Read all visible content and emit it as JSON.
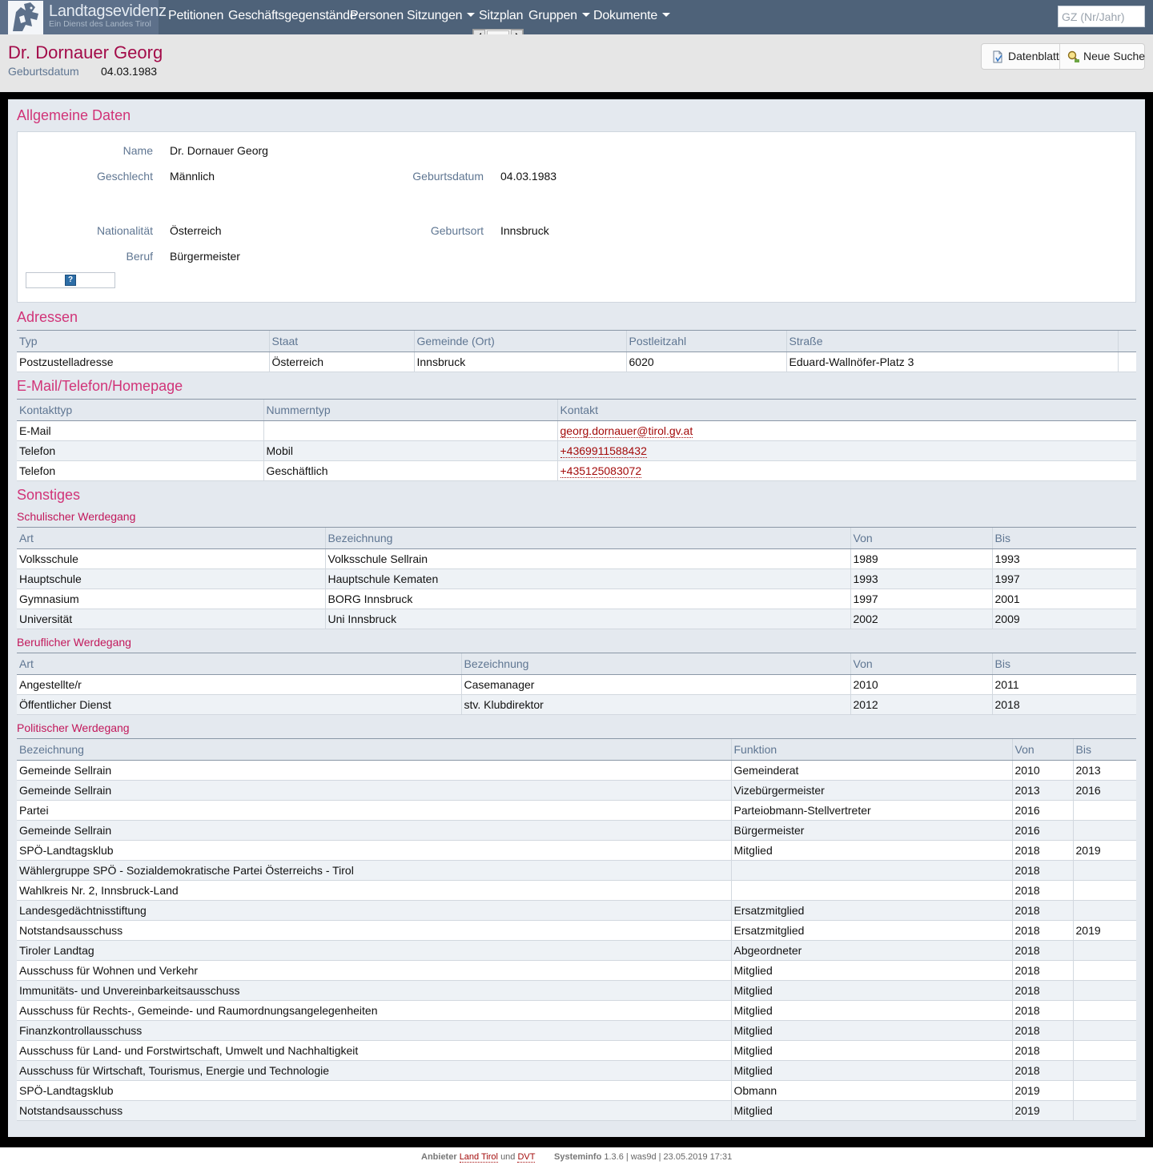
{
  "brand": {
    "title": "Landtagsevidenz",
    "subtitle": "Ein Dienst des Landes Tirol"
  },
  "nav": {
    "items": [
      {
        "label": "Petitionen",
        "dropdown": false
      },
      {
        "label": "Geschäftsgegenstände",
        "dropdown": false
      },
      {
        "label": "Personen",
        "dropdown": false
      },
      {
        "label": "Sitzungen",
        "dropdown": true
      },
      {
        "label": "Sitzplan",
        "dropdown": false
      },
      {
        "label": "Gruppen",
        "dropdown": true
      },
      {
        "label": "Dokumente",
        "dropdown": true
      }
    ],
    "search_placeholder": "GZ (Nr/Jahr)",
    "search_value": ""
  },
  "header": {
    "title": "Dr. Dornauer Georg",
    "dob_label": "Geburtsdatum",
    "dob_value": "04.03.1983",
    "buttons": {
      "datenblatt": "Datenblatt",
      "neue_suche": "Neue Suche"
    }
  },
  "general": {
    "heading": "Allgemeine Daten",
    "name_label": "Name",
    "name": "Dr. Dornauer Georg",
    "gender_label": "Geschlecht",
    "gender": "Männlich",
    "birthdate_label": "Geburtsdatum",
    "birthdate": "04.03.1983",
    "nationality_label": "Nationalität",
    "nationality": "Österreich",
    "birthplace_label": "Geburtsort",
    "birthplace": "Innsbruck",
    "job_label": "Beruf",
    "job": "Bürgermeister",
    "image_placeholder": "?"
  },
  "addresses": {
    "heading": "Adressen",
    "columns": [
      "Typ",
      "Staat",
      "Gemeinde (Ort)",
      "Postleitzahl",
      "Straße"
    ],
    "rows": [
      [
        "Postzustelladresse",
        "Österreich",
        "Innsbruck",
        "6020",
        "Eduard-Wallnöfer-Platz 3"
      ]
    ]
  },
  "contacts": {
    "heading": "E-Mail/Telefon/Homepage",
    "columns": [
      "Kontakttyp",
      "Nummerntyp",
      "Kontakt"
    ],
    "rows": [
      [
        "E-Mail",
        "",
        "georg.dornauer@tirol.gv.at"
      ],
      [
        "Telefon",
        "Mobil",
        "+4369911588432"
      ],
      [
        "Telefon",
        "Geschäftlich",
        "+435125083072"
      ]
    ]
  },
  "misc": {
    "heading": "Sonstiges"
  },
  "school": {
    "heading": "Schulischer Werdegang",
    "columns": [
      "Art",
      "Bezeichnung",
      "Von",
      "Bis"
    ],
    "rows": [
      [
        "Volksschule",
        "Volksschule Sellrain",
        "1989",
        "1993"
      ],
      [
        "Hauptschule",
        "Hauptschule Kematen",
        "1993",
        "1997"
      ],
      [
        "Gymnasium",
        "BORG Innsbruck",
        "1997",
        "2001"
      ],
      [
        "Universität",
        "Uni Innsbruck",
        "2002",
        "2009"
      ]
    ]
  },
  "career": {
    "heading": "Beruflicher Werdegang",
    "columns": [
      "Art",
      "Bezeichnung",
      "Von",
      "Bis"
    ],
    "rows": [
      [
        "Angestellte/r",
        "Casemanager",
        "2010",
        "2011"
      ],
      [
        "Öffentlicher Dienst",
        "stv. Klubdirektor",
        "2012",
        "2018"
      ]
    ]
  },
  "political": {
    "heading": "Politischer Werdegang",
    "columns": [
      "Bezeichnung",
      "Funktion",
      "Von",
      "Bis"
    ],
    "rows": [
      [
        "Gemeinde Sellrain",
        "Gemeinderat",
        "2010",
        "2013"
      ],
      [
        "Gemeinde Sellrain",
        "Vizebürgermeister",
        "2013",
        "2016"
      ],
      [
        "Partei",
        "Parteiobmann-Stellvertreter",
        "2016",
        ""
      ],
      [
        "Gemeinde Sellrain",
        "Bürgermeister",
        "2016",
        ""
      ],
      [
        "SPÖ-Landtagsklub",
        "Mitglied",
        "2018",
        "2019"
      ],
      [
        "Wählergruppe SPÖ - Sozialdemokratische Partei Österreichs - Tirol",
        "",
        "2018",
        ""
      ],
      [
        "Wahlkreis Nr. 2, Innsbruck-Land",
        "",
        "2018",
        ""
      ],
      [
        "Landesgedächtnisstiftung",
        "Ersatzmitglied",
        "2018",
        ""
      ],
      [
        "Notstandsausschuss",
        "Ersatzmitglied",
        "2018",
        "2019"
      ],
      [
        "Tiroler Landtag",
        "Abgeordneter",
        "2018",
        ""
      ],
      [
        "Ausschuss für Wohnen und Verkehr",
        "Mitglied",
        "2018",
        ""
      ],
      [
        "Immunitäts- und Unvereinbarkeitsausschuss",
        "Mitglied",
        "2018",
        ""
      ],
      [
        "Ausschuss für Rechts-, Gemeinde- und Raumordnungsangelegenheiten",
        "Mitglied",
        "2018",
        ""
      ],
      [
        "Finanzkontrollausschuss",
        "Mitglied",
        "2018",
        ""
      ],
      [
        "Ausschuss für Land- und Forstwirtschaft, Umwelt und Nachhaltigkeit",
        "Mitglied",
        "2018",
        ""
      ],
      [
        "Ausschuss für Wirtschaft, Tourismus, Energie und Technologie",
        "Mitglied",
        "2018",
        ""
      ],
      [
        "SPÖ-Landtagsklub",
        "Obmann",
        "2019",
        ""
      ],
      [
        "Notstandsausschuss",
        "Mitglied",
        "2019",
        ""
      ]
    ]
  },
  "footer": {
    "provider_label": "Anbieter",
    "provider_1": "Land Tirol",
    "and": "und",
    "provider_2": "DVT",
    "sysinfo_label": "Systeminfo",
    "sysinfo": "1.3.6 | was9d | 23.05.2019 17:31"
  },
  "colors": {
    "navbar": "#4e6279",
    "heading": "#d13478",
    "title": "#a30b49",
    "label": "#5f7692",
    "link": "#a30b0b"
  }
}
